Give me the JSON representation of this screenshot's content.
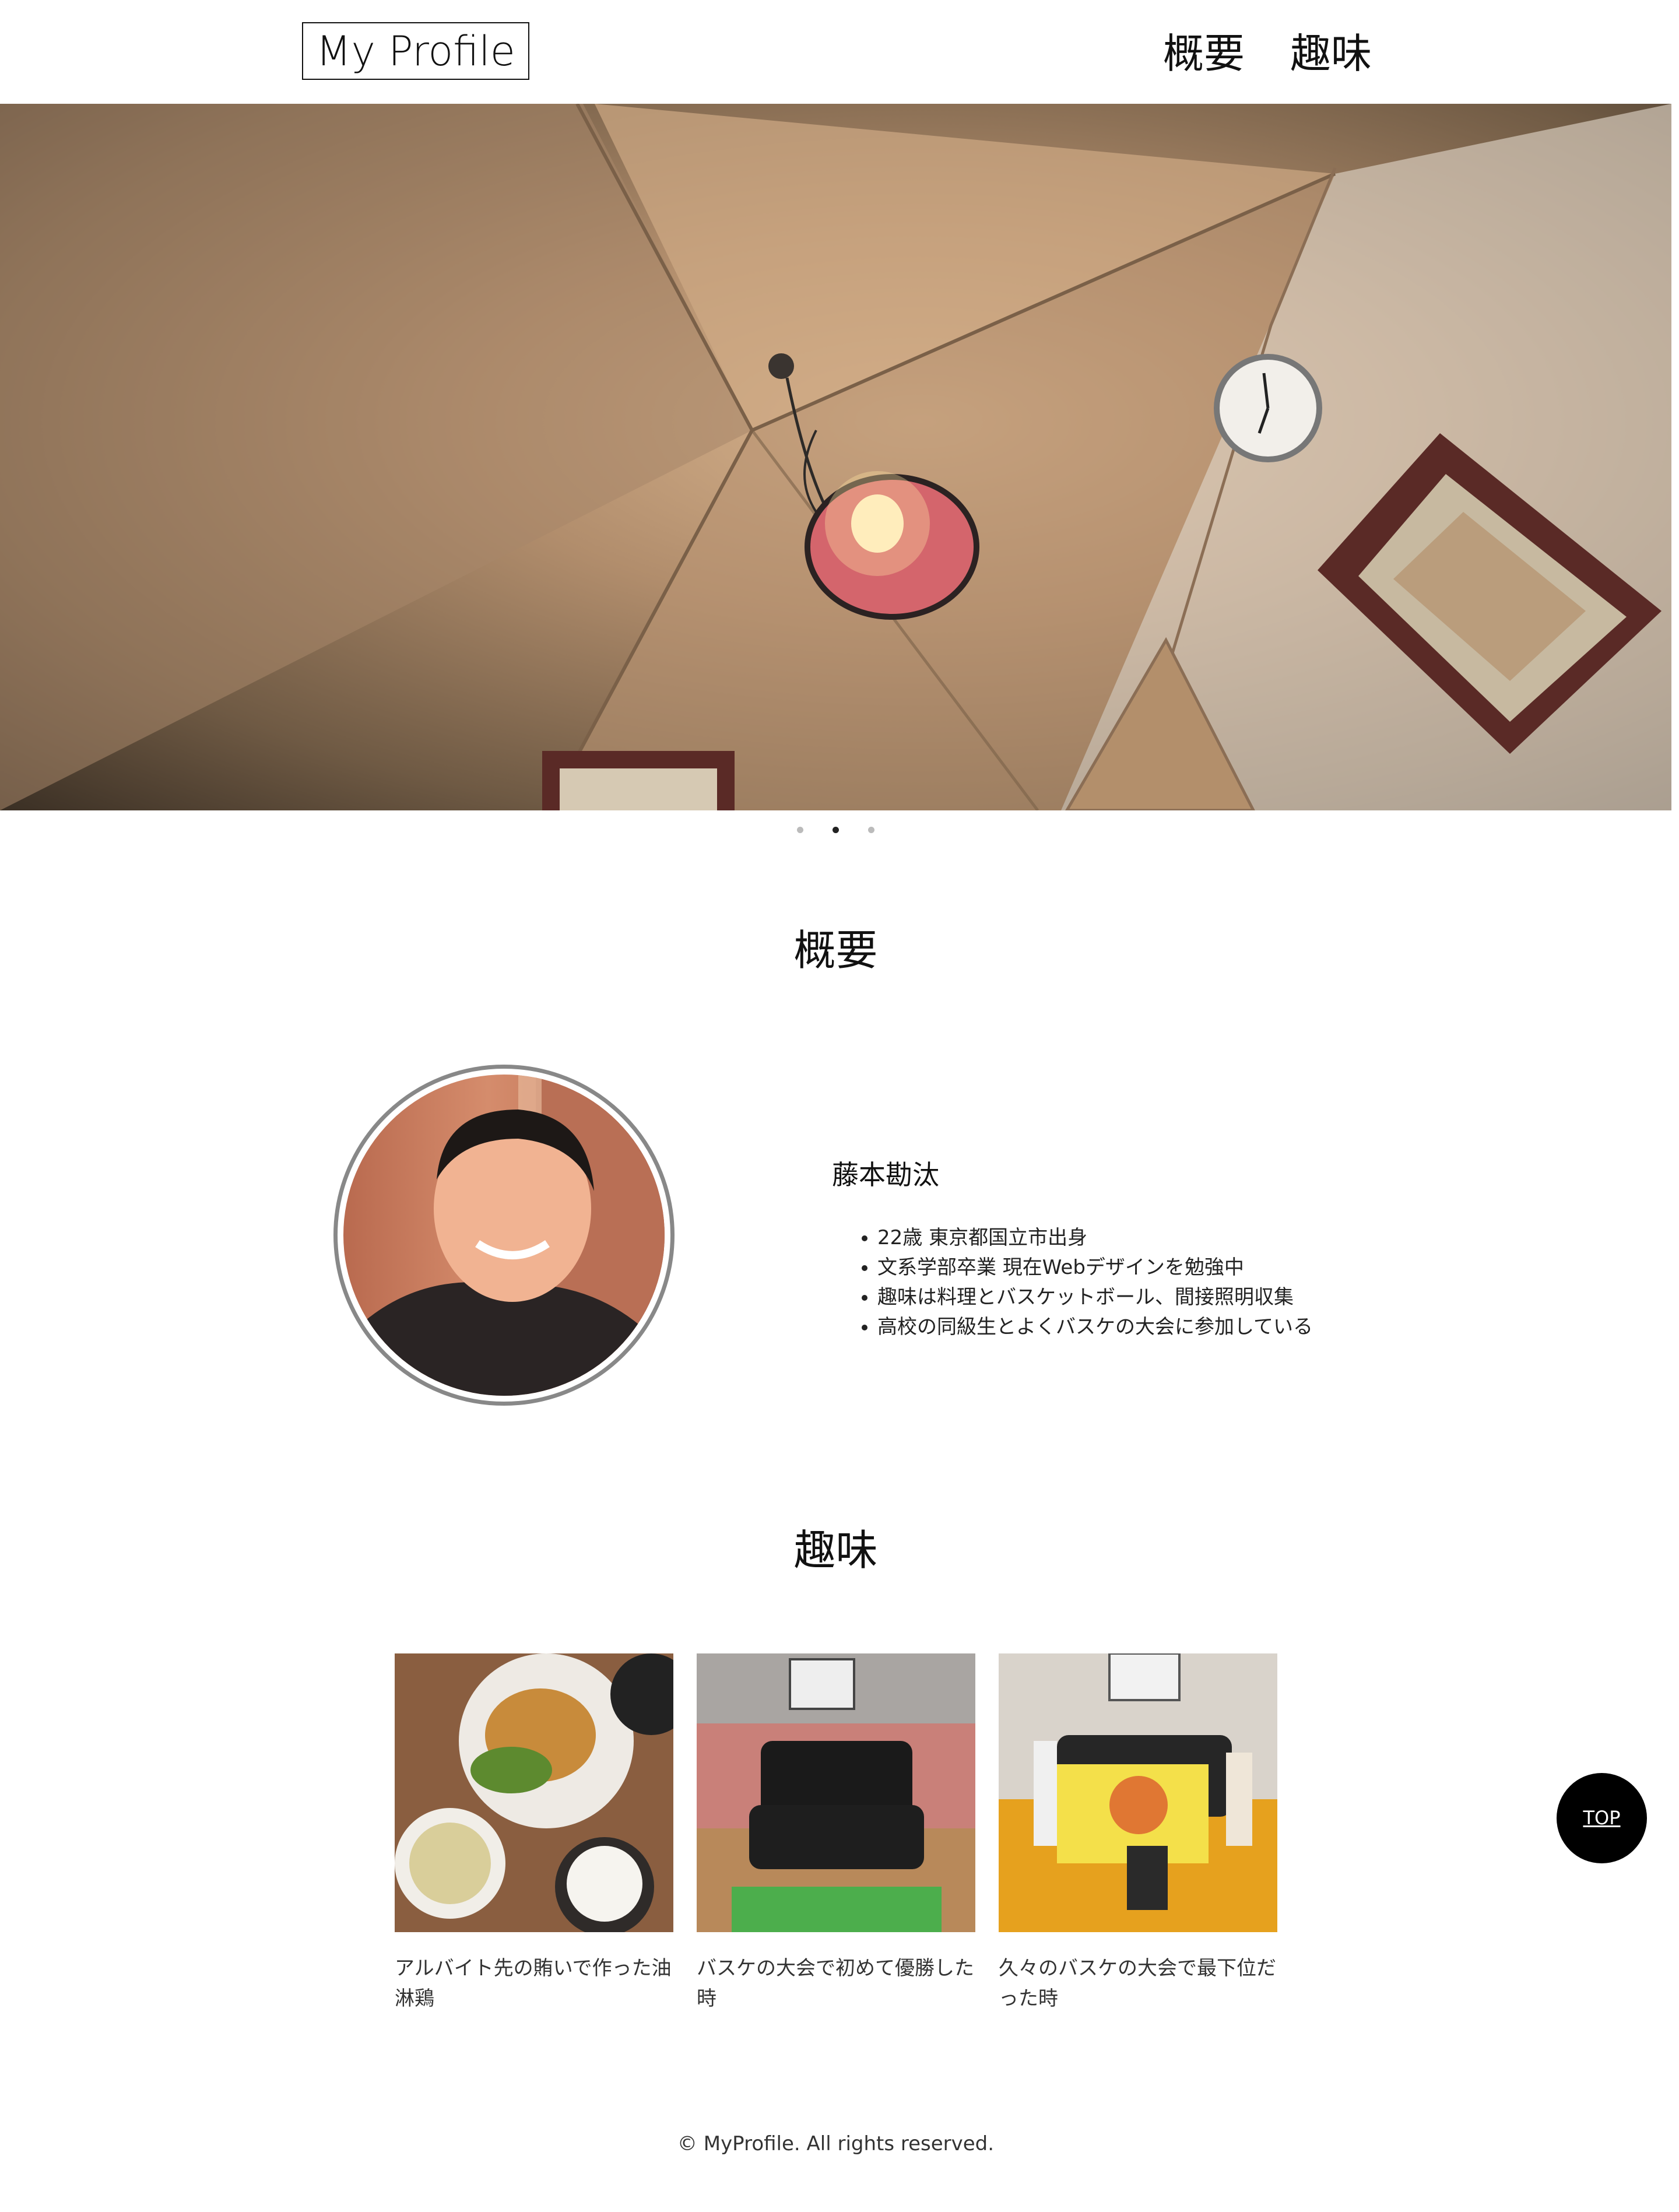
{
  "header": {
    "logo": "My Profile",
    "nav": [
      "概要",
      "趣味"
    ]
  },
  "carousel": {
    "slide_count": 3,
    "active_index": 1
  },
  "overview": {
    "title": "概要",
    "name": "藤本勘汰",
    "details": [
      "22歳 東京都国立市出身",
      "文系学部卒業 現在Webデザインを勉強中",
      "趣味は料理とバスケットボール、間接照明収集",
      "高校の同級生とよくバスケの大会に参加している"
    ]
  },
  "hobbies": {
    "title": "趣味",
    "items": [
      {
        "caption": "アルバイト先の賄いで作った油淋鶏"
      },
      {
        "caption": "バスケの大会で初めて優勝した時"
      },
      {
        "caption": "久々のバスケの大会で最下位だった時"
      }
    ]
  },
  "top_button": "TOP",
  "footer": "© MyProfile. All rights reserved."
}
